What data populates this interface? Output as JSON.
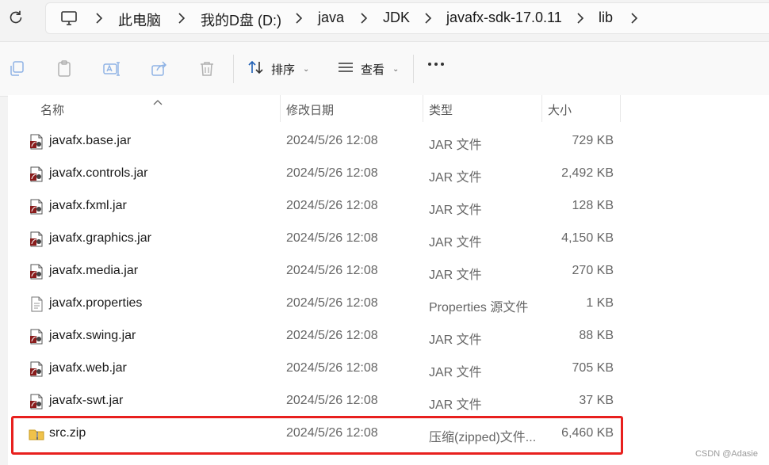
{
  "breadcrumb": [
    "此电脑",
    "我的D盘 (D:)",
    "java",
    "JDK",
    "javafx-sdk-17.0.11",
    "lib"
  ],
  "toolbar": {
    "sort_label": "排序",
    "view_label": "查看"
  },
  "columns": {
    "name": "名称",
    "modified": "修改日期",
    "type": "类型",
    "size": "大小"
  },
  "files": [
    {
      "name": "javafx.base.jar",
      "date": "2024/5/26 12:08",
      "type": "JAR 文件",
      "size": "729 KB",
      "icon": "jar-file-icon"
    },
    {
      "name": "javafx.controls.jar",
      "date": "2024/5/26 12:08",
      "type": "JAR 文件",
      "size": "2,492 KB",
      "icon": "jar-file-icon"
    },
    {
      "name": "javafx.fxml.jar",
      "date": "2024/5/26 12:08",
      "type": "JAR 文件",
      "size": "128 KB",
      "icon": "jar-file-icon"
    },
    {
      "name": "javafx.graphics.jar",
      "date": "2024/5/26 12:08",
      "type": "JAR 文件",
      "size": "4,150 KB",
      "icon": "jar-file-icon"
    },
    {
      "name": "javafx.media.jar",
      "date": "2024/5/26 12:08",
      "type": "JAR 文件",
      "size": "270 KB",
      "icon": "jar-file-icon"
    },
    {
      "name": "javafx.properties",
      "date": "2024/5/26 12:08",
      "type": "Properties 源文件",
      "size": "1 KB",
      "icon": "text-file-icon"
    },
    {
      "name": "javafx.swing.jar",
      "date": "2024/5/26 12:08",
      "type": "JAR 文件",
      "size": "88 KB",
      "icon": "jar-file-icon"
    },
    {
      "name": "javafx.web.jar",
      "date": "2024/5/26 12:08",
      "type": "JAR 文件",
      "size": "705 KB",
      "icon": "jar-file-icon"
    },
    {
      "name": "javafx-swt.jar",
      "date": "2024/5/26 12:08",
      "type": "JAR 文件",
      "size": "37 KB",
      "icon": "jar-file-icon"
    },
    {
      "name": "src.zip",
      "date": "2024/5/26 12:08",
      "type": "压缩(zipped)文件...",
      "size": "6,460 KB",
      "icon": "zip-folder-icon"
    }
  ],
  "highlighted_file": "src.zip",
  "highlight_color": "#e8201e",
  "watermark": "CSDN @Adasie"
}
